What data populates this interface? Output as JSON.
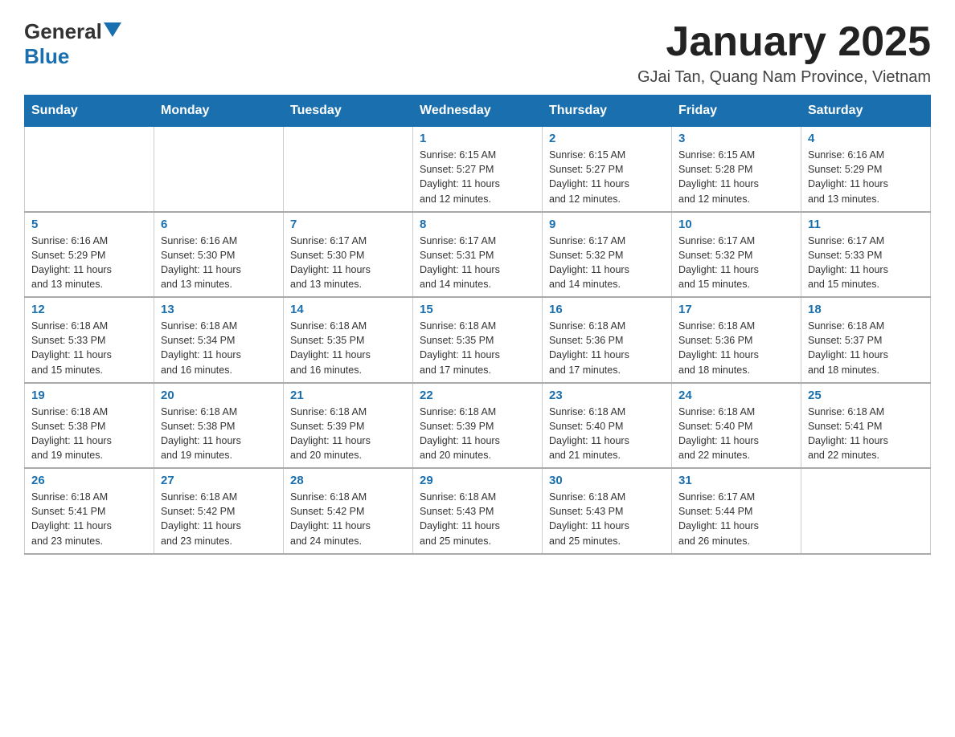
{
  "logo": {
    "name1": "General",
    "name2": "Blue"
  },
  "header": {
    "title": "January 2025",
    "location": "GJai Tan, Quang Nam Province, Vietnam"
  },
  "days_of_week": [
    "Sunday",
    "Monday",
    "Tuesday",
    "Wednesday",
    "Thursday",
    "Friday",
    "Saturday"
  ],
  "weeks": [
    {
      "days": [
        {
          "number": "",
          "info": ""
        },
        {
          "number": "",
          "info": ""
        },
        {
          "number": "",
          "info": ""
        },
        {
          "number": "1",
          "info": "Sunrise: 6:15 AM\nSunset: 5:27 PM\nDaylight: 11 hours\nand 12 minutes."
        },
        {
          "number": "2",
          "info": "Sunrise: 6:15 AM\nSunset: 5:27 PM\nDaylight: 11 hours\nand 12 minutes."
        },
        {
          "number": "3",
          "info": "Sunrise: 6:15 AM\nSunset: 5:28 PM\nDaylight: 11 hours\nand 12 minutes."
        },
        {
          "number": "4",
          "info": "Sunrise: 6:16 AM\nSunset: 5:29 PM\nDaylight: 11 hours\nand 13 minutes."
        }
      ]
    },
    {
      "days": [
        {
          "number": "5",
          "info": "Sunrise: 6:16 AM\nSunset: 5:29 PM\nDaylight: 11 hours\nand 13 minutes."
        },
        {
          "number": "6",
          "info": "Sunrise: 6:16 AM\nSunset: 5:30 PM\nDaylight: 11 hours\nand 13 minutes."
        },
        {
          "number": "7",
          "info": "Sunrise: 6:17 AM\nSunset: 5:30 PM\nDaylight: 11 hours\nand 13 minutes."
        },
        {
          "number": "8",
          "info": "Sunrise: 6:17 AM\nSunset: 5:31 PM\nDaylight: 11 hours\nand 14 minutes."
        },
        {
          "number": "9",
          "info": "Sunrise: 6:17 AM\nSunset: 5:32 PM\nDaylight: 11 hours\nand 14 minutes."
        },
        {
          "number": "10",
          "info": "Sunrise: 6:17 AM\nSunset: 5:32 PM\nDaylight: 11 hours\nand 15 minutes."
        },
        {
          "number": "11",
          "info": "Sunrise: 6:17 AM\nSunset: 5:33 PM\nDaylight: 11 hours\nand 15 minutes."
        }
      ]
    },
    {
      "days": [
        {
          "number": "12",
          "info": "Sunrise: 6:18 AM\nSunset: 5:33 PM\nDaylight: 11 hours\nand 15 minutes."
        },
        {
          "number": "13",
          "info": "Sunrise: 6:18 AM\nSunset: 5:34 PM\nDaylight: 11 hours\nand 16 minutes."
        },
        {
          "number": "14",
          "info": "Sunrise: 6:18 AM\nSunset: 5:35 PM\nDaylight: 11 hours\nand 16 minutes."
        },
        {
          "number": "15",
          "info": "Sunrise: 6:18 AM\nSunset: 5:35 PM\nDaylight: 11 hours\nand 17 minutes."
        },
        {
          "number": "16",
          "info": "Sunrise: 6:18 AM\nSunset: 5:36 PM\nDaylight: 11 hours\nand 17 minutes."
        },
        {
          "number": "17",
          "info": "Sunrise: 6:18 AM\nSunset: 5:36 PM\nDaylight: 11 hours\nand 18 minutes."
        },
        {
          "number": "18",
          "info": "Sunrise: 6:18 AM\nSunset: 5:37 PM\nDaylight: 11 hours\nand 18 minutes."
        }
      ]
    },
    {
      "days": [
        {
          "number": "19",
          "info": "Sunrise: 6:18 AM\nSunset: 5:38 PM\nDaylight: 11 hours\nand 19 minutes."
        },
        {
          "number": "20",
          "info": "Sunrise: 6:18 AM\nSunset: 5:38 PM\nDaylight: 11 hours\nand 19 minutes."
        },
        {
          "number": "21",
          "info": "Sunrise: 6:18 AM\nSunset: 5:39 PM\nDaylight: 11 hours\nand 20 minutes."
        },
        {
          "number": "22",
          "info": "Sunrise: 6:18 AM\nSunset: 5:39 PM\nDaylight: 11 hours\nand 20 minutes."
        },
        {
          "number": "23",
          "info": "Sunrise: 6:18 AM\nSunset: 5:40 PM\nDaylight: 11 hours\nand 21 minutes."
        },
        {
          "number": "24",
          "info": "Sunrise: 6:18 AM\nSunset: 5:40 PM\nDaylight: 11 hours\nand 22 minutes."
        },
        {
          "number": "25",
          "info": "Sunrise: 6:18 AM\nSunset: 5:41 PM\nDaylight: 11 hours\nand 22 minutes."
        }
      ]
    },
    {
      "days": [
        {
          "number": "26",
          "info": "Sunrise: 6:18 AM\nSunset: 5:41 PM\nDaylight: 11 hours\nand 23 minutes."
        },
        {
          "number": "27",
          "info": "Sunrise: 6:18 AM\nSunset: 5:42 PM\nDaylight: 11 hours\nand 23 minutes."
        },
        {
          "number": "28",
          "info": "Sunrise: 6:18 AM\nSunset: 5:42 PM\nDaylight: 11 hours\nand 24 minutes."
        },
        {
          "number": "29",
          "info": "Sunrise: 6:18 AM\nSunset: 5:43 PM\nDaylight: 11 hours\nand 25 minutes."
        },
        {
          "number": "30",
          "info": "Sunrise: 6:18 AM\nSunset: 5:43 PM\nDaylight: 11 hours\nand 25 minutes."
        },
        {
          "number": "31",
          "info": "Sunrise: 6:17 AM\nSunset: 5:44 PM\nDaylight: 11 hours\nand 26 minutes."
        },
        {
          "number": "",
          "info": ""
        }
      ]
    }
  ]
}
